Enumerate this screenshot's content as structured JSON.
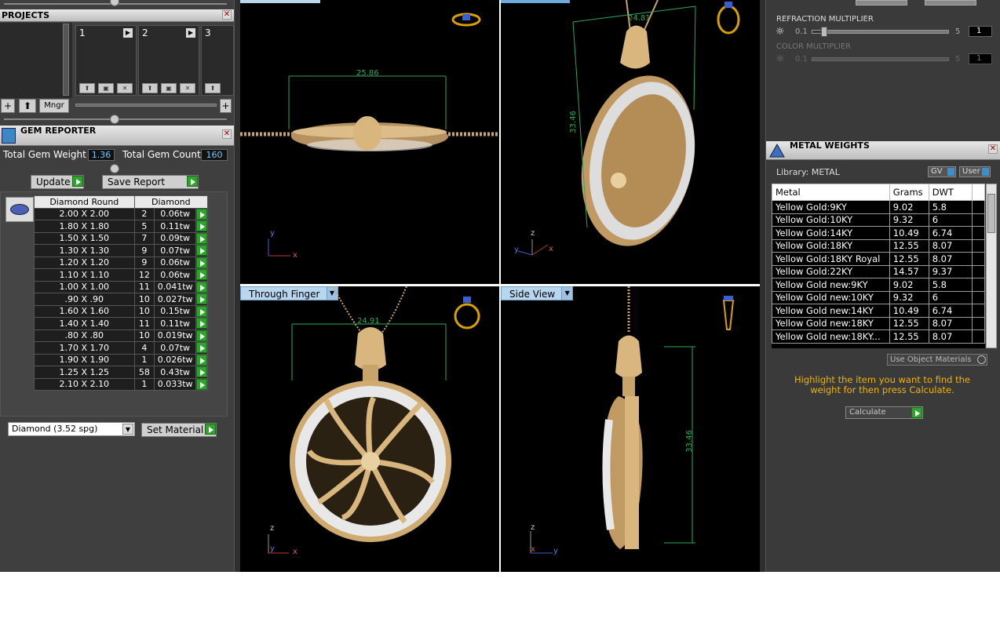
{
  "projects": {
    "title": "PROJECTS",
    "slots": [
      "1",
      "2",
      "3"
    ],
    "mngr_label": "Mngr"
  },
  "gem_reporter": {
    "title": "GEM REPORTER",
    "total_weight_label": "Total Gem Weight",
    "total_weight_value": "1.36",
    "total_count_label": "Total Gem Count",
    "total_count_value": "160",
    "update_label": "Update",
    "save_report_label": "Save Report",
    "col_shape": "Diamond Round",
    "col_material": "Diamond",
    "rows": [
      {
        "size": "2.00 X 2.00",
        "count": "2",
        "weight": "0.06tw"
      },
      {
        "size": "1.80 X 1.80",
        "count": "5",
        "weight": "0.11tw"
      },
      {
        "size": "1.50 X 1.50",
        "count": "7",
        "weight": "0.09tw"
      },
      {
        "size": "1.30 X 1.30",
        "count": "9",
        "weight": "0.07tw"
      },
      {
        "size": "1.20 X 1.20",
        "count": "9",
        "weight": "0.06tw"
      },
      {
        "size": "1.10 X 1.10",
        "count": "12",
        "weight": "0.06tw"
      },
      {
        "size": "1.00 X 1.00",
        "count": "11",
        "weight": "0.041tw"
      },
      {
        "size": ".90 X .90",
        "count": "10",
        "weight": "0.027tw"
      },
      {
        "size": "1.60 X 1.60",
        "count": "10",
        "weight": "0.15tw"
      },
      {
        "size": "1.40 X 1.40",
        "count": "11",
        "weight": "0.11tw"
      },
      {
        "size": ".80 X .80",
        "count": "10",
        "weight": "0.019tw"
      },
      {
        "size": "1.70 X 1.70",
        "count": "4",
        "weight": "0.07tw"
      },
      {
        "size": "1.90 X 1.90",
        "count": "1",
        "weight": "0.026tw"
      },
      {
        "size": "1.25 X 1.25",
        "count": "58",
        "weight": "0.43tw"
      },
      {
        "size": "2.10 X 2.10",
        "count": "1",
        "weight": "0.033tw"
      }
    ],
    "material_select": "Diamond    (3.52 spg)",
    "set_material_label": "Set Material"
  },
  "viewports": {
    "top_left": {
      "dimension": "25.86",
      "axis_a": "y",
      "axis_b": "x"
    },
    "top_right": {
      "dimension_a": "24.81",
      "dimension_b": "33.46",
      "axis_a": "z",
      "axis_b": "y",
      "axis_c": "x"
    },
    "bottom_left": {
      "label": "Through Finger",
      "dimension": "24.91",
      "axis_a": "z",
      "axis_b": "y",
      "axis_c": "x"
    },
    "bottom_right": {
      "label": "Side View",
      "dimension": "33.46",
      "axis_a": "z",
      "axis_b": "x",
      "axis_c": "y"
    }
  },
  "render_settings": {
    "refraction_label": "REFRACTION MULTIPLIER",
    "refraction_min": "0.1",
    "refraction_max": "5",
    "refraction_value": "1",
    "refraction_level": 0.06,
    "color_label": "COLOR MULTIPLIER",
    "color_min": "0.1",
    "color_max": "5",
    "color_value": "1"
  },
  "metal_weights": {
    "title": "METAL WEIGHTS",
    "library_label": "Library: METAL",
    "gv_label": "GV",
    "user_label": "User",
    "col_metal": "Metal",
    "col_grams": "Grams",
    "col_dwt": "DWT",
    "rows": [
      {
        "metal": "Yellow Gold:9KY",
        "grams": "9.02",
        "dwt": "5.8"
      },
      {
        "metal": "Yellow Gold:10KY",
        "grams": "9.32",
        "dwt": "6"
      },
      {
        "metal": "Yellow Gold:14KY",
        "grams": "10.49",
        "dwt": "6.74"
      },
      {
        "metal": "Yellow Gold:18KY",
        "grams": "12.55",
        "dwt": "8.07"
      },
      {
        "metal": "Yellow Gold:18KY Royal",
        "grams": "12.55",
        "dwt": "8.07"
      },
      {
        "metal": "Yellow Gold:22KY",
        "grams": "14.57",
        "dwt": "9.37"
      },
      {
        "metal": "Yellow Gold new:9KY",
        "grams": "9.02",
        "dwt": "5.8"
      },
      {
        "metal": "Yellow Gold new:10KY",
        "grams": "9.32",
        "dwt": "6"
      },
      {
        "metal": "Yellow Gold new:14KY",
        "grams": "10.49",
        "dwt": "6.74"
      },
      {
        "metal": "Yellow Gold new:18KY",
        "grams": "12.55",
        "dwt": "8.07"
      },
      {
        "metal": "Yellow Gold new:18KY...",
        "grams": "12.55",
        "dwt": "8.07"
      }
    ],
    "use_object_materials": "Use Object Materials",
    "hint": "Highlight the item you want to find the weight for then press Calculate.",
    "calculate_label": "Calculate"
  },
  "colors": {
    "gold": "#c9a46a",
    "accent_green": "#2da52d",
    "hint_yellow": "#f0b400",
    "dim_line": "#2aa85a",
    "viewport_label": "#b9d6ef"
  }
}
